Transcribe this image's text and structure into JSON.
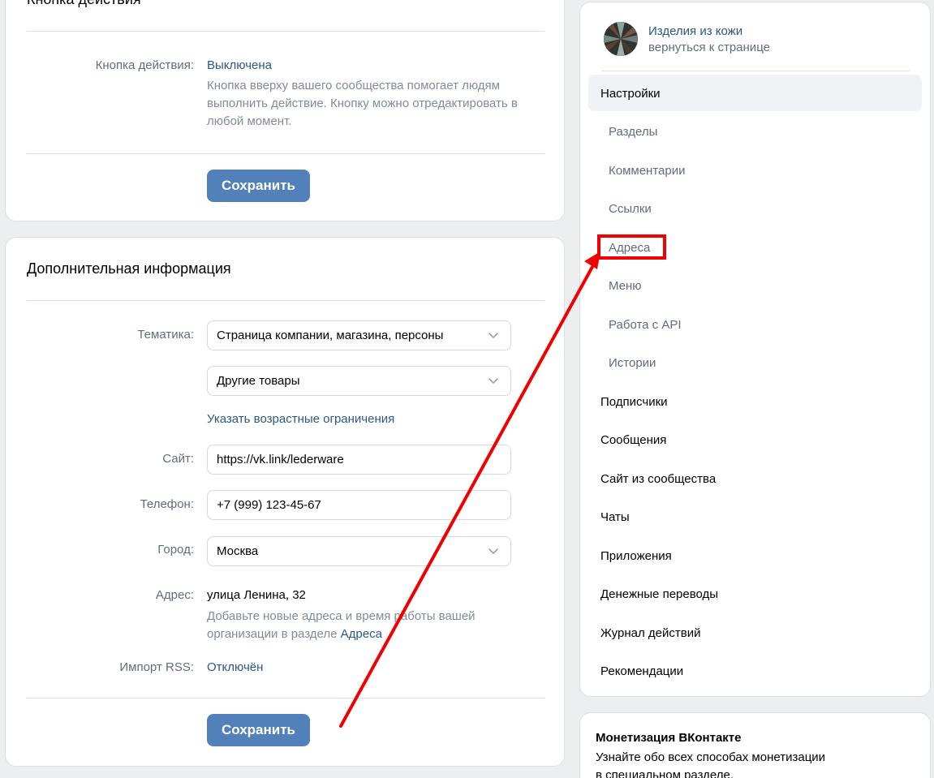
{
  "action_card": {
    "heading": "Кнопка действия",
    "label": "Кнопка действия:",
    "value": "Выключена",
    "hint_line1": "Кнопка вверху вашего сообщества помогает людям",
    "hint_line2": "выполнить действие. Кнопку можно отредактировать в",
    "hint_line3": "любой момент.",
    "save_label": "Сохранить"
  },
  "info_card": {
    "heading": "Дополнительная информация",
    "topic_label": "Тематика:",
    "topic_value": "Страница компании, магазина, персоны",
    "subtopic_value": "Другие товары",
    "age_link": "Указать возрастные ограничения",
    "site_label": "Сайт:",
    "site_value": "https://vk.link/lederware",
    "phone_label": "Телефон:",
    "phone_value": "+7 (999) 123-45-67",
    "city_label": "Город:",
    "city_value": "Москва",
    "address_label": "Адрес:",
    "address_value": "улица Ленина, 32",
    "address_hint_line1": "Добавьте новые адреса и время работы вашей",
    "address_hint_line2_prefix": "организации в разделе ",
    "address_hint_link": "Адреса",
    "rss_label": "Импорт RSS:",
    "rss_value": "Отключён",
    "save_label": "Сохранить"
  },
  "nav": {
    "community_name": "Изделия из кожи",
    "back_link": "вернуться к странице",
    "items": [
      {
        "label": "Настройки",
        "active": true
      },
      {
        "label": "Разделы",
        "sub": true
      },
      {
        "label": "Комментарии",
        "sub": true
      },
      {
        "label": "Ссылки",
        "sub": true
      },
      {
        "label": "Адреса",
        "sub": true,
        "highlighted": true
      },
      {
        "label": "Меню",
        "sub": true
      },
      {
        "label": "Работа с API",
        "sub": true
      },
      {
        "label": "Истории",
        "sub": true
      },
      {
        "label": "Подписчики"
      },
      {
        "label": "Сообщения"
      },
      {
        "label": "Сайт из сообщества"
      },
      {
        "label": "Чаты"
      },
      {
        "label": "Приложения"
      },
      {
        "label": "Денежные переводы"
      },
      {
        "label": "Журнал действий"
      },
      {
        "label": "Рекомендации"
      }
    ]
  },
  "monetization": {
    "title": "Монетизация ВКонтакте",
    "text_line1": "Узнайте обо всех способах монетизации",
    "text_line2": "в специальном разделе."
  },
  "annotation": {
    "color": "#f20000"
  },
  "colors": {
    "accent": "#5181b8",
    "link": "#2a5885",
    "background": "#edeef0"
  }
}
